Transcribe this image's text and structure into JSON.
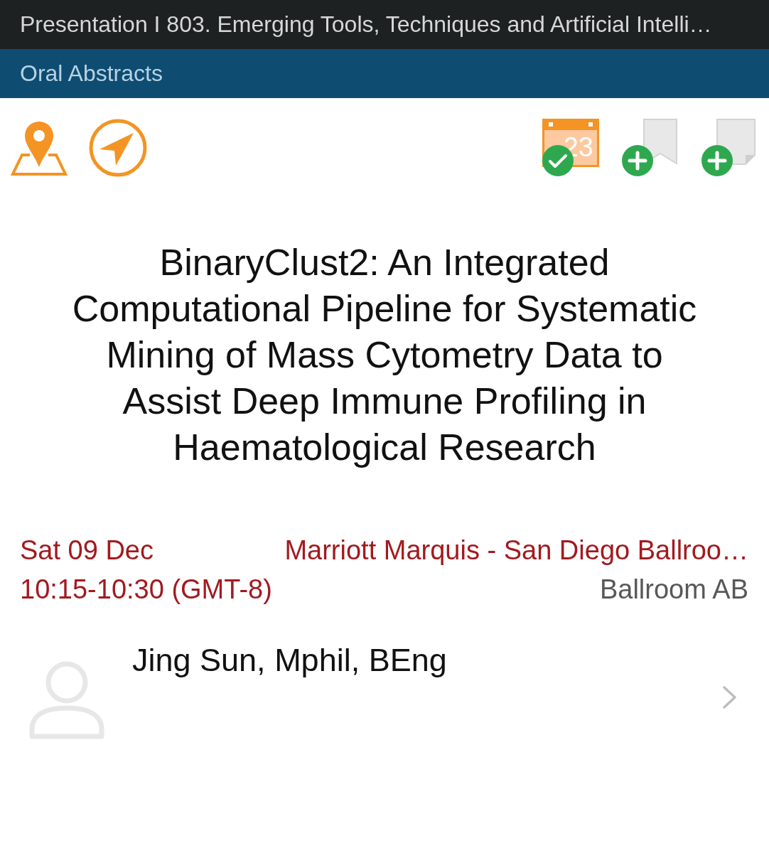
{
  "header": {
    "title": "Presentation I 803. Emerging Tools, Techniques and Artificial Intelli…"
  },
  "session_type": {
    "label": "Oral Abstracts"
  },
  "actions": [
    {
      "kind": "calendar",
      "day": "23",
      "added": true
    },
    {
      "kind": "bookmark",
      "added": false
    },
    {
      "kind": "note",
      "added": false
    }
  ],
  "abstract": {
    "title": "BinaryClust2: An Integrated Computational Pipeline for Systematic Mining of Mass Cytometry Data to Assist Deep Immune Profiling in Haematological Research"
  },
  "schedule": {
    "date": "Sat 09 Dec",
    "time": "10:15-10:30 (GMT-8)",
    "venue": "Marriott Marquis - San Diego Ballroo…",
    "room": "Ballroom AB"
  },
  "speakers": [
    {
      "name": "Jing Sun, Mphil, BEng"
    }
  ]
}
